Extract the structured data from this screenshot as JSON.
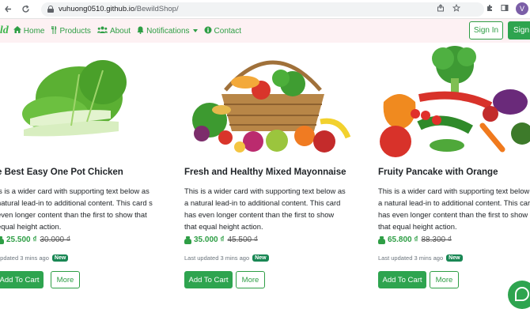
{
  "browser": {
    "url_host": "vuhuong0510.github.io",
    "url_path": "/BewildShop/",
    "profile_initial": "V"
  },
  "navbar": {
    "brand": "ild",
    "links": [
      {
        "label": "Home",
        "icon": "home-icon"
      },
      {
        "label": "Products",
        "icon": "utensils-icon"
      },
      {
        "label": "About",
        "icon": "users-icon"
      },
      {
        "label": "Notifications",
        "icon": "bell-icon"
      },
      {
        "label": "Contact",
        "icon": "info-circle-icon"
      }
    ],
    "signin_label": "Sign In",
    "signup_label": "Sign"
  },
  "cards": [
    {
      "title": "e Best Easy One Pot Chicken",
      "text": "is is a wider card with supporting text below as natural lead-in to additional content. This card s even longer content than the first to show that equal height action.",
      "new_price": "25.500 ₫",
      "old_price": "30.000 ₫",
      "updated": "updated 3 mins ago",
      "badge": "New",
      "add_label": "Add To Cart",
      "more_label": "More"
    },
    {
      "title": "Fresh and Healthy Mixed Mayonnaise",
      "text": "This is a wider card with supporting text below as a natural lead-in to additional content. This card has even longer content than the first to show that equal height action.",
      "new_price": "35.000 ₫",
      "old_price": "45.500 ₫",
      "updated": "Last updated 3 mins ago",
      "badge": "New",
      "add_label": "Add To Cart",
      "more_label": "More"
    },
    {
      "title": "Fruity Pancake with Orange",
      "text": "This is a wider card with supporting text below a a natural lead-in to additional content. This card has even longer content than the first to show that equal height action.",
      "new_price": "65.800 ₫",
      "old_price": "88.300 ₫",
      "updated": "Last updated 3 mins ago",
      "badge": "New",
      "add_label": "Add To Cart",
      "more_label": "More"
    }
  ],
  "colors": {
    "brand_green": "#2e9e45",
    "button_green": "#2ea44f",
    "navbar_bg": "#fdf1f3",
    "badge_green": "#198754"
  }
}
